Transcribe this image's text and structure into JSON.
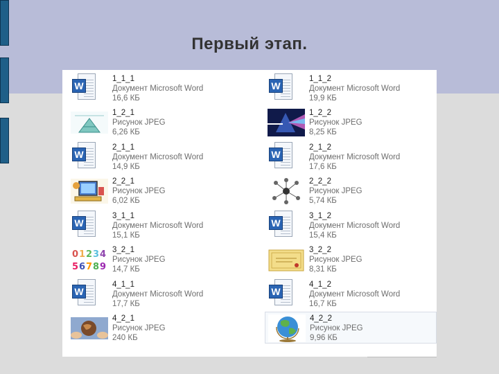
{
  "title": "Первый этап.",
  "files": [
    {
      "name": "1_1_1",
      "type": "Документ Microsoft Word",
      "size": "16,6 КБ",
      "icon": "word-document-icon"
    },
    {
      "name": "1_1_2",
      "type": "Документ Microsoft Word",
      "size": "19,9 КБ",
      "icon": "word-document-icon"
    },
    {
      "name": "1_2_1",
      "type": "Рисунок JPEG",
      "size": "6,26 КБ",
      "icon": "pyramid-image-icon"
    },
    {
      "name": "1_2_2",
      "type": "Рисунок JPEG",
      "size": "8,25 КБ",
      "icon": "prism-image-icon"
    },
    {
      "name": "2_1_1",
      "type": "Документ Microsoft Word",
      "size": "14,9 КБ",
      "icon": "word-document-icon"
    },
    {
      "name": "2_1_2",
      "type": "Документ Microsoft Word",
      "size": "17,6 КБ",
      "icon": "word-document-icon"
    },
    {
      "name": "2_2_1",
      "type": "Рисунок JPEG",
      "size": "6,02 КБ",
      "icon": "computer-image-icon"
    },
    {
      "name": "2_2_2",
      "type": "Рисунок JPEG",
      "size": "5,74 КБ",
      "icon": "network-image-icon"
    },
    {
      "name": "3_1_1",
      "type": "Документ Microsoft Word",
      "size": "15,1 КБ",
      "icon": "word-document-icon"
    },
    {
      "name": "3_1_2",
      "type": "Документ Microsoft Word",
      "size": "15,4 КБ",
      "icon": "word-document-icon"
    },
    {
      "name": "3_2_1",
      "type": "Рисунок JPEG",
      "size": "14,7 КБ",
      "icon": "numbers-image-icon"
    },
    {
      "name": "3_2_2",
      "type": "Рисунок JPEG",
      "size": "8,31 КБ",
      "icon": "certificate-image-icon"
    },
    {
      "name": "4_1_1",
      "type": "Документ Microsoft Word",
      "size": "17,7 КБ",
      "icon": "word-document-icon"
    },
    {
      "name": "4_1_2",
      "type": "Документ Microsoft Word",
      "size": "16,7 КБ",
      "icon": "word-document-icon"
    },
    {
      "name": "4_2_1",
      "type": "Рисунок JPEG",
      "size": "240 КБ",
      "icon": "globe-hands-image-icon"
    },
    {
      "name": "4_2_2",
      "type": "Рисунок JPEG",
      "size": "9,96 КБ",
      "icon": "globe-image-icon"
    }
  ],
  "colors": {
    "top_band": "#b8bcd8",
    "side_tabs": "#1f5f88",
    "background": "#dcdcdc",
    "word_blue": "#2a64b3"
  }
}
